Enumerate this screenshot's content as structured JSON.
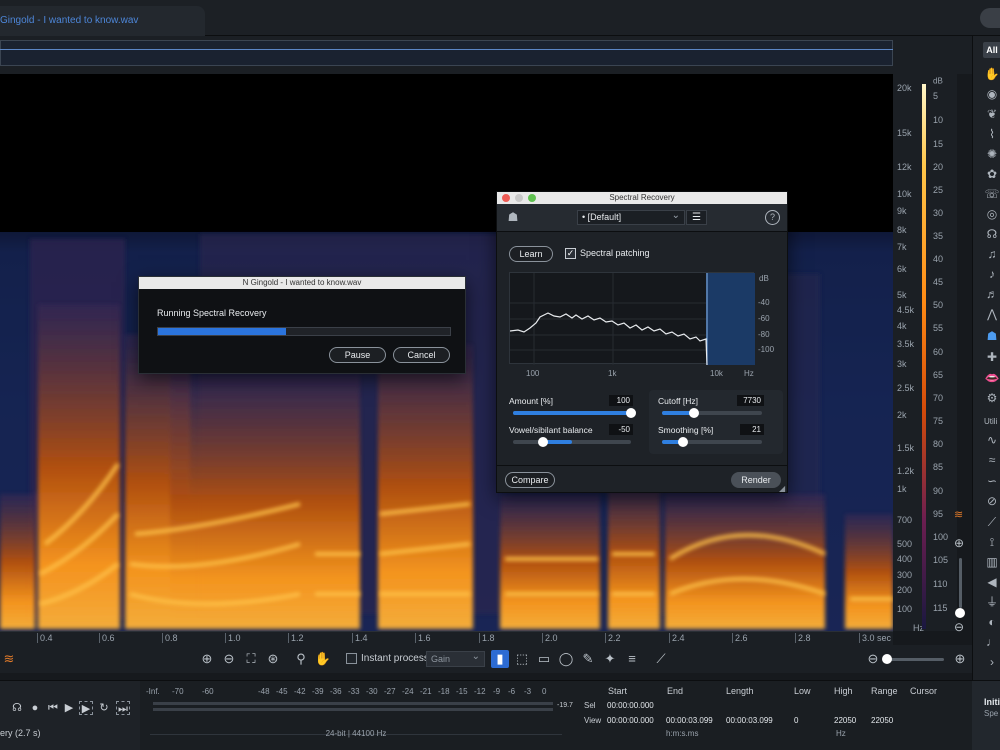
{
  "tab": {
    "title": "Gingold - I wanted to know.wav"
  },
  "frequency_axis": {
    "labels": [
      "20k",
      "15k",
      "12k",
      "10k",
      "9k",
      "8k",
      "7k",
      "6k",
      "5k",
      "4.5k",
      "4k",
      "3.5k",
      "3k",
      "2.5k",
      "2k",
      "1.5k",
      "1.2k",
      "1k",
      "700",
      "500",
      "400",
      "300",
      "200",
      "100"
    ],
    "unit": "Hz"
  },
  "db_axis": {
    "unit": "dB",
    "labels": [
      "5",
      "10",
      "15",
      "20",
      "25",
      "30",
      "35",
      "40",
      "45",
      "50",
      "55",
      "60",
      "65",
      "70",
      "75",
      "80",
      "85",
      "90",
      "95",
      "100",
      "105",
      "110",
      "115"
    ]
  },
  "time_axis": {
    "labels": [
      "0.4",
      "0.6",
      "0.8",
      "1.0",
      "1.2",
      "1.4",
      "1.6",
      "1.8",
      "2.0",
      "2.2",
      "2.4",
      "2.6",
      "2.8",
      "3.0 sec"
    ]
  },
  "modules": {
    "filter_label": "All",
    "section_label": "Utili",
    "active": "spectral-recovery"
  },
  "toolbar": {
    "instant_process_label": "Instant process",
    "instant_process_checked": false,
    "mode_value": "Gain"
  },
  "run_dialog": {
    "title": "N Gingold - I wanted to know.wav",
    "message": "Running Spectral Recovery",
    "progress": 0.44,
    "pause_label": "Pause",
    "cancel_label": "Cancel"
  },
  "spectral_recovery": {
    "title": "Spectral Recovery",
    "preset": "[Default]",
    "learn_label": "Learn",
    "patching_label": "Spectral patching",
    "patching_checked": true,
    "graph": {
      "db_unit": "dB",
      "db_ticks": [
        "-40",
        "-60",
        "-80",
        "-100"
      ],
      "hz_ticks": [
        "100",
        "1k",
        "10k"
      ],
      "hz_unit": "Hz"
    },
    "params": {
      "amount_label": "Amount [%]",
      "amount_value": "100",
      "amount_level": 1.0,
      "vowel_label": "Vowel/sibilant balance",
      "vowel_value": "-50",
      "vowel_level": 0.25,
      "cutoff_label": "Cutoff [Hz]",
      "cutoff_value": "7730",
      "cutoff_level": 0.32,
      "smoothing_label": "Smoothing [%]",
      "smoothing_value": "21",
      "smoothing_level": 0.21
    },
    "compare_label": "Compare",
    "render_label": "Render"
  },
  "transport": {
    "history_label": "ery (2.7 s)"
  },
  "meter": {
    "scale": [
      "-Inf.",
      "-70",
      "-60",
      "-48",
      "-45",
      "-42",
      "-39",
      "-36",
      "-33",
      "-30",
      "-27",
      "-24",
      "-21",
      "-18",
      "-15",
      "-12",
      "-9",
      "-6",
      "-3",
      "0"
    ],
    "peak": "-19.7",
    "format": "24-bit | 44100 Hz"
  },
  "selection": {
    "headers": {
      "start": "Start",
      "end": "End",
      "length": "Length",
      "low": "Low",
      "high": "High",
      "range": "Range",
      "cursor": "Cursor"
    },
    "sel_label": "Sel",
    "view_label": "View",
    "sel_start": "00:00:00.000",
    "view_start": "00:00:00.000",
    "view_end": "00:00:03.099",
    "view_length": "00:00:03.099",
    "low": "0",
    "high": "22050",
    "range": "22050",
    "time_unit": "h:m:s.ms",
    "freq_unit": "Hz"
  },
  "init_panel": {
    "title": "Initi",
    "subtitle": "Spe"
  }
}
